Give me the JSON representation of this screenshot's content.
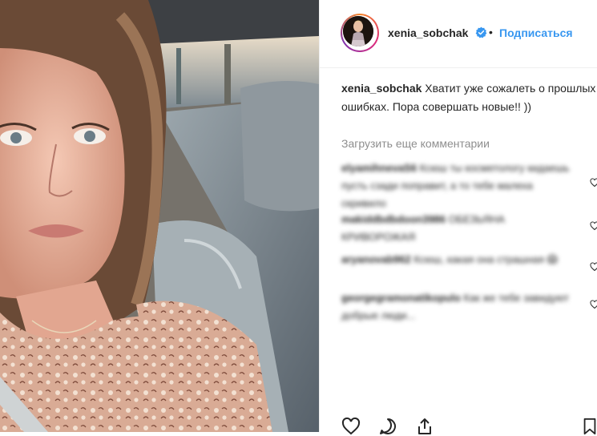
{
  "post": {
    "username": "xenia_sobchak",
    "follow_label": "Подписаться",
    "separator": "•",
    "caption_user": "xenia_sobchak",
    "caption_text": "Хватит уже сожалеть о прошлых ошибках. Пора совершать новые!! ))",
    "load_more_label": "Загрузить еще комментарии"
  },
  "comments": [
    {
      "user": "elyamihnevaS6",
      "text": "Ксюш ты косметологу кидаешь пусть сзади поправит, а то тебе малеха скривило"
    },
    {
      "user": "makiddbdbdoon3986",
      "text": "ОБЕЗЬЯНА КРИВОРОЖАЯ"
    },
    {
      "user": "aryanovab962",
      "text": "Ксюш, какая она страшная 😱"
    },
    {
      "user": "georgegramonatikopulo",
      "text": "Как же тебе завидуют добрые люди..."
    }
  ],
  "icons": {
    "verified": "verified-badge-icon",
    "like": "heart-icon",
    "comment": "comment-icon",
    "share": "share-icon",
    "save": "bookmark-icon"
  },
  "colors": {
    "link_blue": "#3897f0",
    "verified_blue": "#3897f0",
    "muted_text": "#8e8e8e"
  }
}
